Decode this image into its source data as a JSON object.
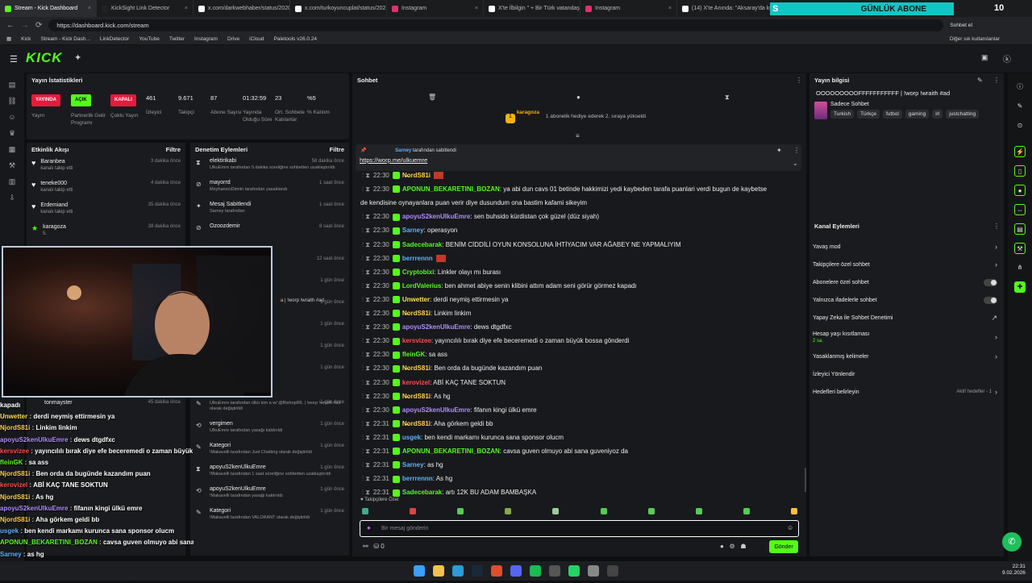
{
  "browser": {
    "tabs": [
      {
        "label": "Stream - Kick Dashboard",
        "color": "#53fc18"
      },
      {
        "label": "KickSight Link Detector",
        "color": "#222"
      },
      {
        "label": "x.com/darkwebhaber/status/2020",
        "color": "#fff"
      },
      {
        "label": "x.com/turkoyuncuplat/status/202",
        "color": "#fff"
      },
      {
        "label": "Instagram",
        "color": "#e1306c"
      },
      {
        "label": "X'te İlbilgin \" + Bir Türk vatandaş",
        "color": "#fff"
      },
      {
        "label": "Instagram",
        "color": "#e1306c"
      },
      {
        "label": "(14) X'te Anında: \"Aksaray'da küçü",
        "color": "#fff"
      }
    ],
    "url": "https://dashboard.kick.com/stream",
    "chat_btn": "Sohbet et",
    "bookmarks": [
      "Kick",
      "Stream - Kick Dash...",
      "LinkDetector",
      "YouTube",
      "Twitter",
      "Instagram",
      "Drive",
      "iCloud",
      "Paletools v26.0.24"
    ],
    "other_bookmarks": "Diğer sık kullanılanlar"
  },
  "overlay": {
    "banner": "GÜNLÜK ABONE",
    "s": "S",
    "count": "10"
  },
  "logo": "KICK",
  "stats": {
    "title": "Yayın İstatistikleri",
    "pills": [
      {
        "label": "YAYINDA",
        "color": "#e8193c",
        "text": "Yayın"
      },
      {
        "label": "AÇIK",
        "color": "#53fc18",
        "text": "Partnerlik Gelir Programı"
      },
      {
        "label": "KAPALI",
        "color": "#e8193c",
        "text": "Çoklu Yayın"
      }
    ],
    "items": [
      {
        "v": "461",
        "l": "İzleyici"
      },
      {
        "v": "9.671",
        "l": "Takipçi"
      },
      {
        "v": "87",
        "l": "Abone Sayısı"
      },
      {
        "v": "01:32:59",
        "l": "Yayında Olduğu Süre"
      },
      {
        "v": "23",
        "l": "Ort. Sohbete Katılanlar"
      },
      {
        "v": "%5",
        "l": "% Katılım"
      }
    ]
  },
  "activity": {
    "title": "Etkinlik Akışı",
    "filter": "Filtre",
    "rows": [
      {
        "name": "Baranbea",
        "sub": "kanalı takip etti",
        "time": "3 dakika önce",
        "icon": "♥"
      },
      {
        "name": "teneke000",
        "sub": "kanalı takip etti",
        "time": "4 dakika önce",
        "icon": "♥"
      },
      {
        "name": "Erdemiand",
        "sub": "kanalı takip etti",
        "time": "35 dakika önce",
        "icon": "♥"
      },
      {
        "name": "karagoza",
        "sub": "5.",
        "time": "38 dakika önce",
        "icon": "★"
      }
    ],
    "bottom": [
      {
        "name": "tonmayster",
        "time": "45 dakika önce"
      }
    ]
  },
  "moderation": {
    "title": "Denetim Eylemleri",
    "filter": "Filtre",
    "rows": [
      {
        "name": "elektirikabi",
        "sub": "UlkuEmre tarafından 5 dakika süreliğine sohbetten uzaklaştırıldı",
        "time": "58 dakika önce",
        "icon": "⧗"
      },
      {
        "name": "mayorrd",
        "sub": "MeyhaneciDimitri tarafından yasaklandı",
        "time": "1 saat önce",
        "icon": "⊘"
      },
      {
        "name": "Mesaj Sabitlendi",
        "sub": "Sarney tarafından",
        "time": "1 saat önce",
        "icon": "✦"
      },
      {
        "name": "Ozoozdemir",
        "sub": "",
        "time": "8 saat önce",
        "icon": "⊘"
      }
    ],
    "extra_times": [
      "12 saat önce",
      "1 gün önce",
      "1 gün önce",
      "1 gün önce",
      "1 gün önce",
      "1 gün önce"
    ],
    "extra_fragment": "a | !worp !wraith #ad",
    "bottom": [
      {
        "name": "",
        "sub": "UlkuEmre tarafından ülkü kim a w/ @BishopIRL | !worp !wraith #ad olarak değiştirildi",
        "time": "1 gün önce",
        "icon": "✎"
      },
      {
        "name": "vergimen",
        "sub": "UlkuEmre tarafından yasağı kaldırıldı",
        "time": "1 gün önce",
        "icon": "⟲"
      },
      {
        "name": "Kategori",
        "sub": "!Makavelli tarafından Just Chatting olarak değiştirildi",
        "time": "1 gün önce",
        "icon": "✎"
      },
      {
        "name": "apoyuS2kenUlkuEmre",
        "sub": "!Makavelli tarafından 1 saat süreliğine sohbetten uzaklaştırıldı",
        "time": "1 gün önce",
        "icon": "⧗"
      },
      {
        "name": "apoyuS2kenUlkuEmre",
        "sub": "!Makavelli tarafından yasağı kaldırıldı",
        "time": "1 gün önce",
        "icon": "⟲"
      },
      {
        "name": "Kategori",
        "sub": "!Makavelli tarafından VALORANT olarak değiştirildi",
        "time": "1 gün önce",
        "icon": "✎"
      }
    ]
  },
  "overlay_chat": [
    {
      "u": "kapadı",
      "c": "#fff",
      "m": ""
    },
    {
      "u": "Unwetter",
      "c": "#ffe047",
      "m": "derdi neymiş ettirmesin ya"
    },
    {
      "u": "NjordS81i",
      "c": "#ffd24a",
      "m": "Linkim linkim"
    },
    {
      "u": "apoyuS2kenUlkuEmre",
      "c": "#b18cff",
      "m": "dews dtgdfxc"
    },
    {
      "u": "kersvizee",
      "c": "#ff4d4d",
      "m": "yayıncılılı bırak diye efe beceremedi o zaman büyük bossa gönderdi"
    },
    {
      "u": "fleinGK",
      "c": "#53fc18",
      "m": "sa ass"
    },
    {
      "u": "NjordS81i",
      "c": "#ffd24a",
      "m": "Ben orda da bugünde kazandım puan"
    },
    {
      "u": "kerovizel",
      "c": "#ff4d4d",
      "m": "ABİ KAÇ TANE SOKTUN"
    },
    {
      "u": "NjordS81i",
      "c": "#ffd24a",
      "m": "As hg"
    },
    {
      "u": "apoyuS2kenUlkuEmre",
      "c": "#b18cff",
      "m": "fifanın kingi ülkü emre"
    },
    {
      "u": "NjordS81i",
      "c": "#ffd24a",
      "m": "Aha görkem geldi bb"
    },
    {
      "u": "usgek",
      "c": "#5ab4ff",
      "m": "ben kendi markamı kurunca sana sponsor olucm"
    },
    {
      "u": "APONUN_BEKARETINI_BOZAN",
      "c": "#53fc18",
      "m": "cavsa guven olmuyo abi sana guveniyoz da"
    },
    {
      "u": "Sarney",
      "c": "#5ab4ff",
      "m": "as hg"
    },
    {
      "u": "berrrennn",
      "c": "#5ab4ff",
      "m": "As hg"
    },
    {
      "u": "Sadecebarak",
      "c": "#53fc18",
      "m": "artı 12K BU ADAM BAMBAŞKA"
    }
  ],
  "chat": {
    "title": "Sohbet",
    "event_user": "karagoza",
    "event_text": "1 abonelik hediye ederek 2. sıraya yükseldi",
    "pinned_by": "Sarney",
    "pinned_label": "tarafından sabitlendi",
    "pinned_link": "https://worp.me/ulkuemre",
    "messages": [
      {
        "t": "22:30",
        "u": "N̶ordS81i",
        "c": "#ffd24a",
        "m": ""
      },
      {
        "t": "22:30",
        "u": "APONUN_BEKARETINI_BOZAN",
        "c": "#53fc18",
        "m": "ya abi dun cavs 01 betinde hakkimizi yedi kaybeden tarafa puanlari verdi bugun de kaybetse"
      },
      {
        "t": "",
        "u": "",
        "c": "#fff",
        "m": "de kendisine oynayanlara puan verir diye dusundum ona bastim kafami sikeyim"
      },
      {
        "t": "22:30",
        "u": "apoyuS2kenUlkuEmre",
        "c": "#b18cff",
        "m": "sen buhsido kürdistan çok güzel (düz siyah)"
      },
      {
        "t": "22:30",
        "u": "Sarney",
        "c": "#5ab4ff",
        "m": "operasyon"
      },
      {
        "t": "22:30",
        "u": "Sadecebarak",
        "c": "#53fc18",
        "m": "BENİM CİDDİLİ OYUN KONSOLUNA İHTİYACIM VAR AĞABEY NE YAPMALIYIM"
      },
      {
        "t": "22:30",
        "u": "berrrennn",
        "c": "#5ab4ff",
        "m": ""
      },
      {
        "t": "22:30",
        "u": "Cryptobixi",
        "c": "#53fc18",
        "m": "Linkler olayı mı burası"
      },
      {
        "t": "22:30",
        "u": "LordValerius",
        "c": "#53fc18",
        "m": "ben ahmet abiye senin klibini attım adam seni görür görmez kapadı"
      },
      {
        "t": "22:30",
        "u": "Unwetter",
        "c": "#ffe047",
        "m": "derdi neymiş ettirmesin ya"
      },
      {
        "t": "22:30",
        "u": "N̶ordS81i",
        "c": "#ffd24a",
        "m": "Linkim linkim"
      },
      {
        "t": "22:30",
        "u": "apoyuS2kenUlkuEmre",
        "c": "#b18cff",
        "m": "dews dtgdfxc"
      },
      {
        "t": "22:30",
        "u": "kersvizee",
        "c": "#ff4d4d",
        "m": "yayıncılılı bırak diye efe beceremedi o zaman büyük bossa gönderdi"
      },
      {
        "t": "22:30",
        "u": "fleinGK",
        "c": "#53fc18",
        "m": "sa ass"
      },
      {
        "t": "22:30",
        "u": "N̶ordS81i",
        "c": "#ffd24a",
        "m": "Ben orda da bugünde kazandım puan"
      },
      {
        "t": "22:30",
        "u": "kerovizel",
        "c": "#ff4d4d",
        "m": "ABİ KAÇ TANE SOKTUN"
      },
      {
        "t": "22:30",
        "u": "N̶ordS81i",
        "c": "#ffd24a",
        "m": "As hg"
      },
      {
        "t": "22:30",
        "u": "apoyuS2kenUlkuEmre",
        "c": "#b18cff",
        "m": "fifanın kingi ülkü emre"
      },
      {
        "t": "22:31",
        "u": "N̶ordS81i",
        "c": "#ffd24a",
        "m": "Aha görkem geldi bb"
      },
      {
        "t": "22:31",
        "u": "usgek",
        "c": "#5ab4ff",
        "m": "ben kendi markamı kurunca sana sponsor olucm"
      },
      {
        "t": "22:31",
        "u": "APONUN_BEKARETINI_BOZAN",
        "c": "#53fc18",
        "m": "cavsa guven olmuyo abi sana guveniyoz da"
      },
      {
        "t": "22:31",
        "u": "Sarney",
        "c": "#5ab4ff",
        "m": "as hg"
      },
      {
        "t": "22:31",
        "u": "berrrennn",
        "c": "#5ab4ff",
        "m": "As hg"
      },
      {
        "t": "22:31",
        "u": "Sadecebarak",
        "c": "#53fc18",
        "m": "artı 12K BU ADAM BAMBAŞKA"
      }
    ],
    "followers_only": "Takipçilere Özel",
    "placeholder": "Bir mesaj gönderin",
    "send": "Gönder",
    "count": "0"
  },
  "info": {
    "title": "Yayın bilgisi",
    "stream_title": "OOOOOOOOOFFFFFFFFFFF | !worp !wraith #ad",
    "category": "Sadece Sohbet",
    "tags": [
      "Turkish",
      "Türkçe",
      "futbol",
      "gaming",
      "irl",
      "justchatting"
    ]
  },
  "actions": {
    "title": "Kanal Eylemleri",
    "items": [
      {
        "label": "Yavaş mod",
        "type": "arrow"
      },
      {
        "label": "Takipçilere özel sohbet",
        "type": "arrow"
      },
      {
        "label": "Abonelere özel sohbet",
        "type": "toggle"
      },
      {
        "label": "Yalnızca ifadelerle sohbet",
        "type": "toggle"
      },
      {
        "label": "Yapay Zeka ile Sohbet Denetimi",
        "type": "ext"
      },
      {
        "label": "Hesap yaşı kısıtlaması",
        "type": "arrow",
        "sub": "2 sa."
      },
      {
        "label": "Yasaklanmış kelimeler",
        "type": "arrow"
      },
      {
        "label": "İzleyici Yönlendir",
        "type": "none"
      },
      {
        "label": "Hedefleri belirleyin",
        "type": "arrow",
        "extra": "Aktif hedefler - 1"
      }
    ]
  },
  "taskbar": {
    "time": "22:31",
    "date": "9.02.2026"
  }
}
